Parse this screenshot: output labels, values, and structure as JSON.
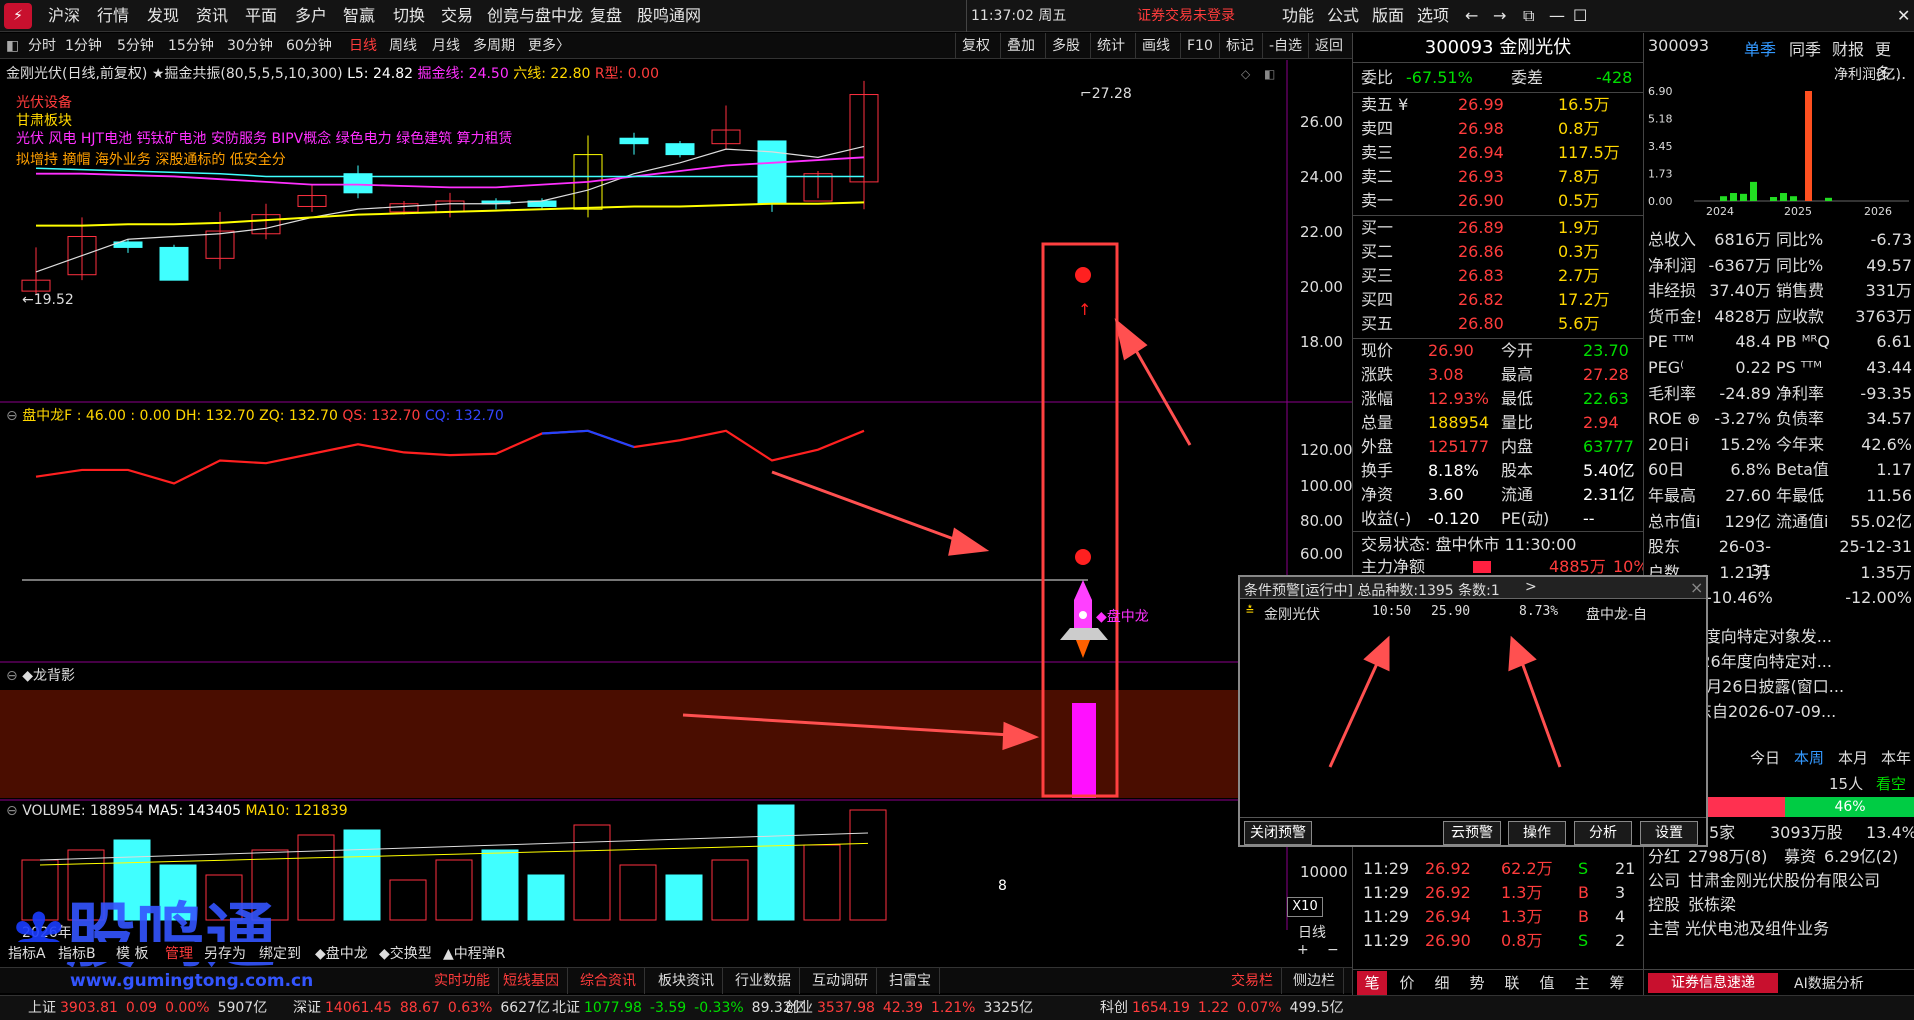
{
  "menubar": {
    "items": [
      "沪深",
      "行情",
      "发现",
      "资讯",
      "平面",
      "多户",
      "智赢",
      "切换",
      "交易",
      "创竟与盘中龙",
      "复盘",
      "股鸣通网"
    ],
    "time": "11:37:02 周五",
    "notice": "证券交易未登录",
    "right": [
      "功能",
      "公式",
      "版面",
      "选项"
    ]
  },
  "toolbar": {
    "periods": [
      "分时",
      "1分钟",
      "5分钟",
      "15分钟",
      "30分钟",
      "60分钟",
      "日线",
      "周线",
      "月线",
      "多周期",
      "更多〉"
    ],
    "right": [
      "复权",
      "叠加",
      "多股",
      "统计",
      "画线",
      "F10",
      "标记",
      "-自选",
      "返回"
    ]
  },
  "chart_header": {
    "name": "金刚光伏(日线,前复权)",
    "indicator": "★掘金共振(80,5,5,5,10,300)",
    "l5": "L5: 24.82",
    "jjx": "掘金线: 24.50",
    "lx": "六线: 22.80",
    "rx": "R型: 0.00"
  },
  "concepts": {
    "l1": "光伏设备",
    "l2": "甘肃板块",
    "l3": "光伏 风电 HJT电池 钙钛矿电池 安防服务 BIPV概念 绿色电力 绿色建筑 算力租赁",
    "l4": "拟增持 摘帽 海外业务 深股通标的 低安全分"
  },
  "price_axis": [
    "26.00",
    "24.00",
    "22.00",
    "20.00",
    "18.00"
  ],
  "price_marks": {
    "high": "27.28",
    "low": "←19.52"
  },
  "panzhong": {
    "hdr": "盘中龙F : 46.00 : 0.00",
    "dh": "DH: 132.70",
    "zq": "ZQ: 132.70",
    "qs": "QS: 132.70",
    "cq": "CQ: 132.70",
    "axis": [
      "120.00",
      "100.00",
      "80.00",
      "60.00"
    ],
    "label": "◆盘中龙"
  },
  "longbei": {
    "hdr": "◆龙背影"
  },
  "volume": {
    "hdr": "VOLUME: 188954",
    "ma5": "MA5: 143405",
    "ma10": "MA10: 121839",
    "axis": "10000",
    "x10": "X10",
    "date": "2026年",
    "period": "日线"
  },
  "chart_tabs": [
    "指标A",
    "指标B",
    "模 板",
    "管理",
    "另存为",
    "绑定到",
    "◆盘中龙",
    "◆交换型",
    "▲中程弹R"
  ],
  "quote": {
    "code": "300093 金刚光伏",
    "weibi": "-67.51%",
    "weicha": "-428",
    "sells": [
      [
        "卖五 ¥",
        "26.99",
        "16.5万"
      ],
      [
        "卖四",
        "26.98",
        "0.8万"
      ],
      [
        "卖三",
        "26.94",
        "117.5万"
      ],
      [
        "卖二",
        "26.93",
        "7.8万"
      ],
      [
        "卖一",
        "26.90",
        "0.5万"
      ]
    ],
    "buys": [
      [
        "买一",
        "26.89",
        "1.9万"
      ],
      [
        "买二",
        "26.86",
        "0.3万"
      ],
      [
        "买三",
        "26.83",
        "2.7万"
      ],
      [
        "买四",
        "26.82",
        "17.2万"
      ],
      [
        "买五",
        "26.80",
        "5.6万"
      ]
    ],
    "stats": [
      [
        "现价",
        "26.90",
        "今开",
        "23.70"
      ],
      [
        "涨跌",
        "3.08",
        "最高",
        "27.28"
      ],
      [
        "涨幅",
        "12.93%",
        "最低",
        "22.63"
      ],
      [
        "总量",
        "188954",
        "量比",
        "2.94"
      ],
      [
        "外盘",
        "125177",
        "内盘",
        "63777"
      ],
      [
        "换手",
        "8.18%",
        "股本",
        "5.40亿"
      ],
      [
        "净资",
        "3.60",
        "流通",
        "2.31亿"
      ],
      [
        "收益(-)",
        "-0.120",
        "PE(动)",
        "--"
      ]
    ],
    "status": "交易状态: 盘中休市 11:30:00",
    "zljl": "主力净额",
    "zljl_val": "4885万",
    "zljl_pct": "10%",
    "ticks": [
      [
        "11:29",
        "26.92",
        "62.2万",
        "S",
        "21"
      ],
      [
        "11:29",
        "26.92",
        "1.3万",
        "B",
        "3"
      ],
      [
        "11:29",
        "26.94",
        "1.3万",
        "B",
        "4"
      ],
      [
        "11:29",
        "26.90",
        "0.8万",
        "S",
        "2"
      ]
    ],
    "tabs": [
      "笔",
      "价",
      "细",
      "势",
      "联",
      "值",
      "主",
      "筹"
    ]
  },
  "f10": {
    "code": "300093",
    "tabs": [
      "单季",
      "同季",
      "财报",
      "更多..."
    ],
    "chart_title": "净利润(亿)",
    "yaxis": [
      "6.90",
      "5.18",
      "3.45",
      "1.73",
      "0.00"
    ],
    "years": [
      "2024",
      "2025",
      "2026"
    ],
    "bars": [
      0.3,
      0.5,
      0.45,
      1.2,
      0.25,
      0.5,
      0.3,
      6.9,
      0.2
    ],
    "rows": [
      [
        "总收入",
        "6816万",
        "同比%",
        "-6.73"
      ],
      [
        "净利润",
        "-6367万",
        "同比%",
        "49.57"
      ],
      [
        "非经损",
        "37.40万",
        "销售费",
        "331万"
      ],
      [
        "货币金!",
        "4828万",
        "应收款",
        "3763万"
      ],
      [
        "PE ᵀᵀᴹ",
        "48.4",
        "PB ᴹᴿQ",
        "6.61"
      ],
      [
        "PEG⁽",
        "0.22",
        "PS ᵀᵀᴹ",
        "43.44"
      ],
      [
        "毛利率",
        "-24.89",
        "净利率",
        "-93.35"
      ],
      [
        "ROE ⊕",
        "-3.27%",
        "负债率",
        "34.57"
      ],
      [
        "20日i",
        "15.2%",
        "今年来",
        "42.6%"
      ],
      [
        "60日",
        "6.8%",
        "Beta值",
        "1.17"
      ],
      [
        "年最高",
        "27.60",
        "年最低",
        "11.56"
      ],
      [
        "总市值i",
        "129亿",
        "流通值i",
        "55.02亿"
      ],
      [
        "股东",
        "26-03-31",
        "",
        "25-12-31"
      ],
      [
        "户数",
        "1.21万",
        "",
        "1.35万"
      ],
      [
        "",
        "-10.46%",
        "",
        "-12.00%"
      ]
    ],
    "news": [
      "2026年度向特定对象发...",
      "关于2026年度向特定对...",
      "中报于8月26日披露(窗口...",
      "控股股东自2026-07-09..."
    ],
    "weektabs": [
      "今日",
      "本周",
      "本月",
      "本年"
    ],
    "people": "15人",
    "look": "看空",
    "pct": "46%",
    "inst": [
      "5家",
      "3093万股",
      "13.4%"
    ],
    "fenhong": [
      "分红",
      "2798万(8)",
      "募资",
      "6.29亿(2)"
    ],
    "company": [
      "公司",
      "甘肃金刚光伏股份有限公司"
    ],
    "holder": [
      "控股",
      "张栋梁"
    ],
    "main": "主营 光伏电池及组件业务",
    "bottomtabs": [
      "证券信息速递",
      "AI数据分析"
    ]
  },
  "alert": {
    "title": "条件预警[运行中] 总品种数:1395 条数:1",
    "close": "×",
    "row": [
      "金刚光伏",
      "10:50",
      "25.90",
      "8.73%",
      "盘中龙-自"
    ],
    "buttons": [
      "关闭预警",
      "云预警",
      "操作",
      "分析",
      "设置"
    ]
  },
  "bottom_toolbar": [
    "实时功能",
    "短线基因",
    "综合资讯",
    "板块资讯",
    "行业数据",
    "互动调研",
    "扫雷宝",
    "交易栏",
    "侧边栏"
  ],
  "watermark": {
    "cn": "股鸣通",
    "url": "www.gumingtong.com.cn"
  },
  "index_bar": [
    [
      "上证",
      "3903.81",
      "0.09",
      "0.00%",
      "5907亿"
    ],
    [
      "深证",
      "14061.45",
      "88.67",
      "0.63%",
      "6627亿"
    ],
    [
      "北证",
      "1077.98",
      "-3.59",
      "-0.33%",
      "89.32亿"
    ],
    [
      "创业",
      "3537.98",
      "42.39",
      "1.21%",
      "3325亿"
    ],
    [
      "科创",
      "1654.19",
      "1.22",
      "0.07%",
      "499.5亿"
    ]
  ]
}
